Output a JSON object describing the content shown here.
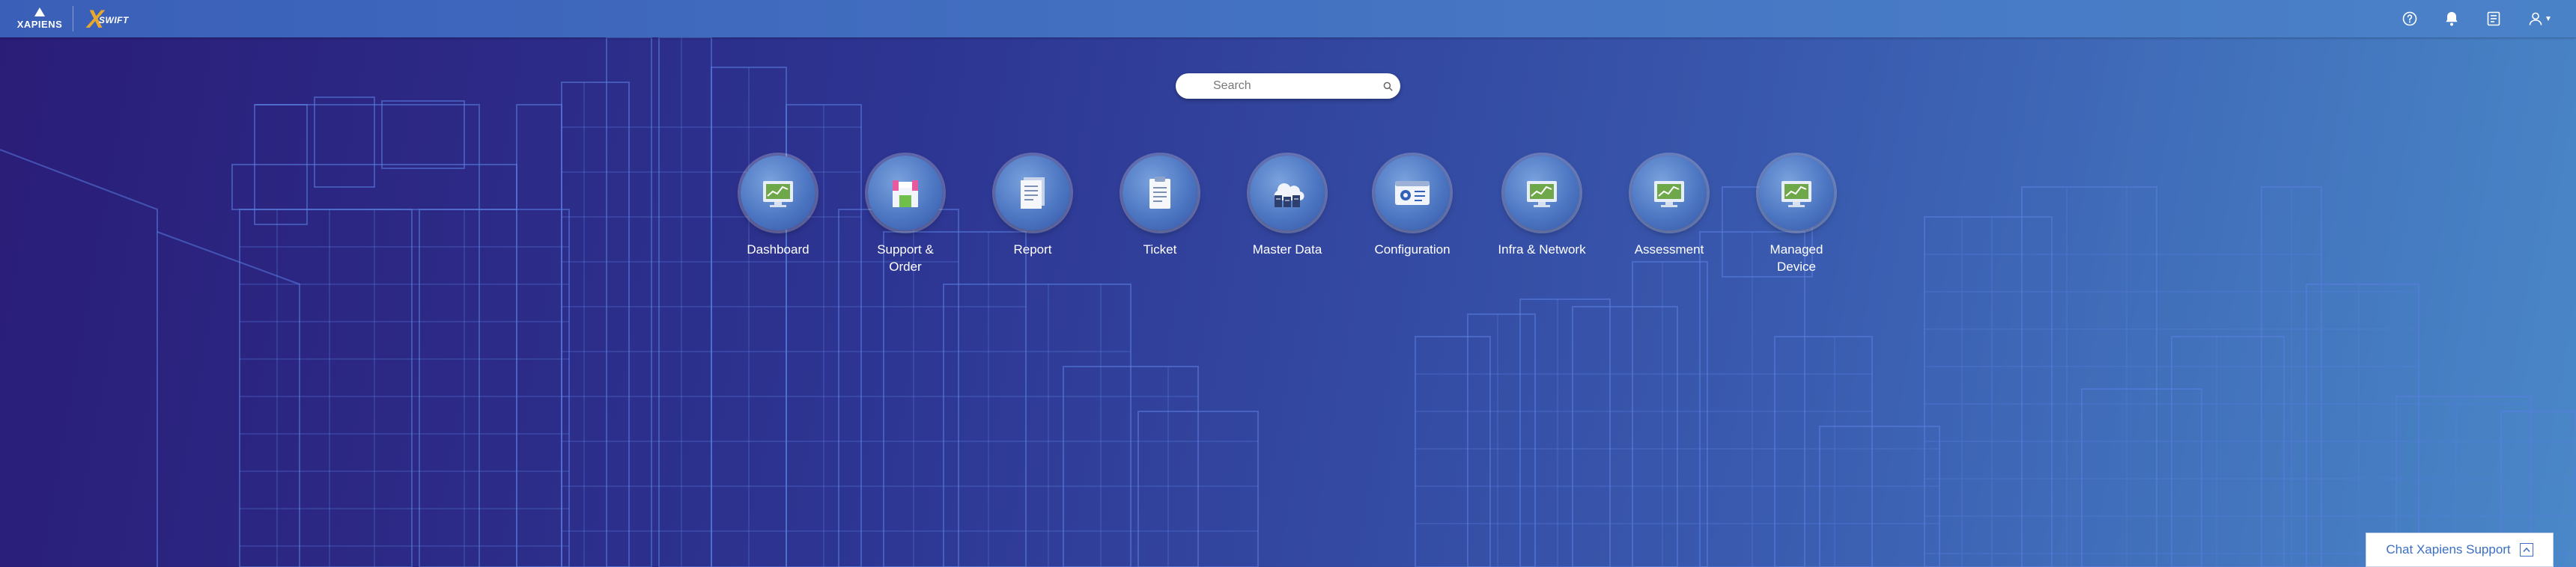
{
  "header": {
    "brand": "XAPIENS",
    "product_mark": "X",
    "product_word": "SWIFT",
    "icons": [
      "help-icon",
      "bell-icon",
      "notes-icon",
      "user-icon"
    ]
  },
  "search": {
    "placeholder": "Search"
  },
  "menu": [
    {
      "label": "Dashboard",
      "icon": "dashboard-icon"
    },
    {
      "label": "Support & Order",
      "icon": "support-order-icon"
    },
    {
      "label": "Report",
      "icon": "report-icon"
    },
    {
      "label": "Ticket",
      "icon": "ticket-icon"
    },
    {
      "label": "Master Data",
      "icon": "master-data-icon"
    },
    {
      "label": "Configuration",
      "icon": "configuration-icon"
    },
    {
      "label": "Infra & Network",
      "icon": "infra-network-icon"
    },
    {
      "label": "Assessment",
      "icon": "assessment-icon"
    },
    {
      "label": "Managed Device",
      "icon": "managed-device-icon"
    }
  ],
  "chat": {
    "label": "Chat Xapiens Support"
  },
  "colors": {
    "accent": "#3b6fc4",
    "logo_orange": "#e8a82e",
    "topbar": "#4676c4"
  }
}
